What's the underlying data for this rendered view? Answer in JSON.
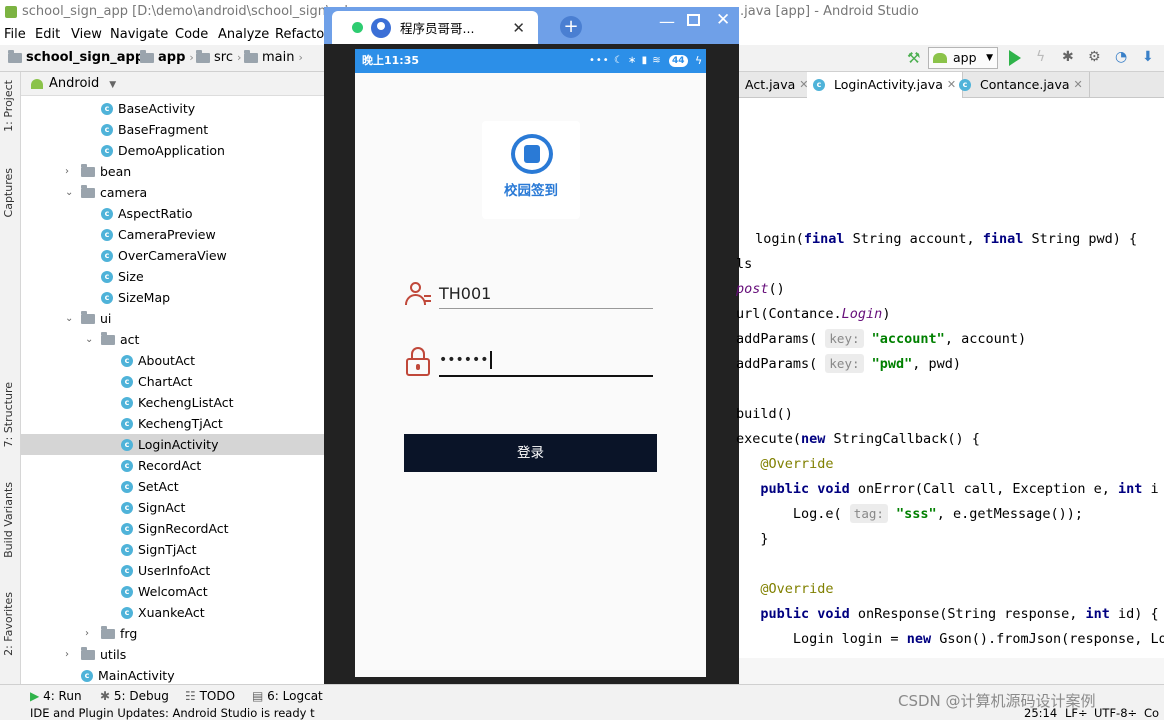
{
  "ide": {
    "title_left": "school_sign_app [D:\\demo\\android\\school_sign\\sch",
    "title_right": ".java [app] - Android Studio",
    "menu": [
      "File",
      "Edit",
      "View",
      "Navigate",
      "Code",
      "Analyze",
      "Refactor"
    ],
    "breadcrumb": [
      "school_sign_app",
      "app",
      "src",
      "main"
    ],
    "project_view": "Android",
    "run_config": "app",
    "left_tabs": [
      "1: Project",
      "Captures",
      "7: Structure",
      "Build Variants",
      "2: Favorites"
    ],
    "tree": [
      {
        "label": "BaseActivity",
        "kind": "class",
        "depth": 4
      },
      {
        "label": "BaseFragment",
        "kind": "class",
        "depth": 4
      },
      {
        "label": "DemoApplication",
        "kind": "class",
        "depth": 4
      },
      {
        "label": "bean",
        "kind": "folder",
        "depth": 3,
        "arrow": "›"
      },
      {
        "label": "camera",
        "kind": "folder",
        "depth": 3,
        "arrow": "⌄"
      },
      {
        "label": "AspectRatio",
        "kind": "class",
        "depth": 4
      },
      {
        "label": "CameraPreview",
        "kind": "class",
        "depth": 4
      },
      {
        "label": "OverCameraView",
        "kind": "class",
        "depth": 4
      },
      {
        "label": "Size",
        "kind": "class",
        "depth": 4
      },
      {
        "label": "SizeMap",
        "kind": "class",
        "depth": 4
      },
      {
        "label": "ui",
        "kind": "folder",
        "depth": 3,
        "arrow": "⌄"
      },
      {
        "label": "act",
        "kind": "folder",
        "depth": 4,
        "arrow": "⌄"
      },
      {
        "label": "AboutAct",
        "kind": "class",
        "depth": 5
      },
      {
        "label": "ChartAct",
        "kind": "class",
        "depth": 5
      },
      {
        "label": "KechengListAct",
        "kind": "class",
        "depth": 5
      },
      {
        "label": "KechengTjAct",
        "kind": "class",
        "depth": 5
      },
      {
        "label": "LoginActivity",
        "kind": "class",
        "depth": 5,
        "selected": true
      },
      {
        "label": "RecordAct",
        "kind": "class",
        "depth": 5
      },
      {
        "label": "SetAct",
        "kind": "class",
        "depth": 5
      },
      {
        "label": "SignAct",
        "kind": "class",
        "depth": 5
      },
      {
        "label": "SignRecordAct",
        "kind": "class",
        "depth": 5
      },
      {
        "label": "SignTjAct",
        "kind": "class",
        "depth": 5
      },
      {
        "label": "UserInfoAct",
        "kind": "class",
        "depth": 5
      },
      {
        "label": "WelcomAct",
        "kind": "class",
        "depth": 5
      },
      {
        "label": "XuankeAct",
        "kind": "class",
        "depth": 5
      },
      {
        "label": "frg",
        "kind": "folder",
        "depth": 4,
        "arrow": "›"
      },
      {
        "label": "utils",
        "kind": "folder",
        "depth": 3,
        "arrow": "›"
      },
      {
        "label": "MainActivity",
        "kind": "class",
        "depth": 3
      }
    ],
    "editor_tabs": [
      "Act.java",
      "LoginActivity.java",
      "Contance.java"
    ],
    "bottom_tabs": [
      "4: Run",
      "5: Debug",
      "TODO",
      "6: Logcat"
    ],
    "status_message": "IDE and Plugin Updates: Android Studio is ready t",
    "status_right": [
      "25:14",
      "LF÷",
      "UTF-8÷",
      "Co"
    ],
    "watermark": "CSDN @计算机源码设计案例"
  },
  "code": [
    {
      "parts": [
        [
          " login(",
          ""
        ],
        [
          "final",
          "kw"
        ],
        [
          " String account, ",
          ""
        ],
        [
          "final",
          "kw"
        ],
        [
          " String pwd) {",
          ""
        ]
      ]
    },
    {
      "parts": [
        [
          "ls",
          ""
        ]
      ]
    },
    {
      "parts": [
        [
          "post",
          "it"
        ],
        [
          "()",
          ""
        ]
      ]
    },
    {
      "parts": [
        [
          "url(Contance.",
          ""
        ],
        [
          "Login",
          "it"
        ],
        [
          ")",
          ""
        ]
      ]
    },
    {
      "parts": [
        [
          "addParams( ",
          ""
        ],
        [
          "key:",
          "hint"
        ],
        [
          " ",
          ""
        ],
        [
          "\"account\"",
          "str"
        ],
        [
          ", account)",
          ""
        ]
      ]
    },
    {
      "parts": [
        [
          "addParams( ",
          ""
        ],
        [
          "key:",
          "hint"
        ],
        [
          " ",
          ""
        ],
        [
          "\"pwd\"",
          "str"
        ],
        [
          ", pwd)",
          ""
        ]
      ]
    },
    {
      "parts": [
        [
          "",
          ""
        ]
      ]
    },
    {
      "parts": [
        [
          "build()",
          ""
        ]
      ]
    },
    {
      "parts": [
        [
          "execute(",
          ""
        ],
        [
          "new",
          "kw"
        ],
        [
          " StringCallback() {",
          ""
        ]
      ]
    },
    {
      "parts": [
        [
          "   ",
          ""
        ],
        [
          "@Override",
          "ann"
        ]
      ]
    },
    {
      "parts": [
        [
          "   ",
          ""
        ],
        [
          "public void",
          "kw"
        ],
        [
          " onError(Call call, Exception e, ",
          ""
        ],
        [
          "int",
          "kw"
        ],
        [
          " i",
          ""
        ]
      ]
    },
    {
      "parts": [
        [
          "       Log.e( ",
          ""
        ],
        [
          "tag:",
          "hint"
        ],
        [
          " ",
          ""
        ],
        [
          "\"sss\"",
          "str"
        ],
        [
          ", e.getMessage());",
          ""
        ]
      ]
    },
    {
      "parts": [
        [
          "   }",
          ""
        ]
      ]
    },
    {
      "parts": [
        [
          "",
          ""
        ]
      ]
    },
    {
      "parts": [
        [
          "   ",
          ""
        ],
        [
          "@Override",
          "ann"
        ]
      ]
    },
    {
      "parts": [
        [
          "   ",
          ""
        ],
        [
          "public void",
          "kw"
        ],
        [
          " onResponse(String response, ",
          ""
        ],
        [
          "int",
          "kw"
        ],
        [
          " id) {",
          ""
        ]
      ]
    },
    {
      "parts": [
        [
          "       Login login = ",
          ""
        ],
        [
          "new",
          "kw"
        ],
        [
          " Gson().fromJson(response, Lo",
          ""
        ]
      ]
    }
  ],
  "emulator": {
    "tab_title": "程序员哥哥...",
    "status_time": "晚上11:35",
    "battery": "44",
    "logo_text": "校园签到",
    "account_value": "TH001",
    "password_mask": "••••••",
    "login_button": "登录",
    "colors": {
      "status": "#2c8fe8",
      "button": "#0a1428",
      "icon": "#c0483a",
      "tab": "#6fa0e8"
    }
  }
}
